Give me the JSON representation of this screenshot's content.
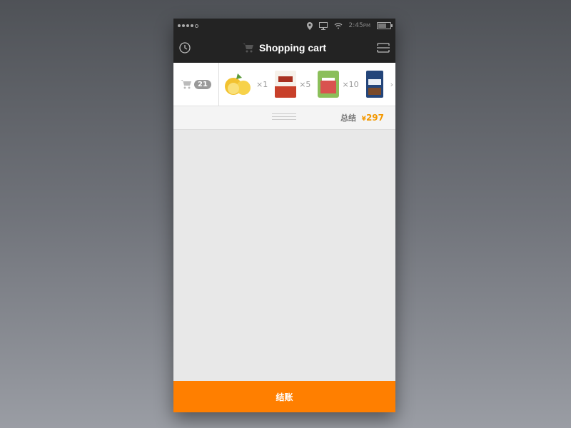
{
  "status_bar": {
    "time": "2:45",
    "ampm": "PM"
  },
  "header": {
    "title": "Shopping cart"
  },
  "cart": {
    "count": "21",
    "items": [
      {
        "name": "lemons",
        "qty": "×1",
        "color": "#f2c230"
      },
      {
        "name": "red-pepper-paste",
        "qty": "×5",
        "color": "#c8402a"
      },
      {
        "name": "kimchi",
        "qty": "×10",
        "color": "#8bbf5a"
      },
      {
        "name": "noodles",
        "qty": "",
        "color": "#23457a"
      }
    ],
    "more": "›"
  },
  "summary": {
    "label": "总结",
    "currency": "¥",
    "total": "297"
  },
  "checkout": {
    "label": "结账"
  },
  "colors": {
    "accent": "#ff7f00",
    "price": "#f39800",
    "header_bg": "#232323"
  }
}
